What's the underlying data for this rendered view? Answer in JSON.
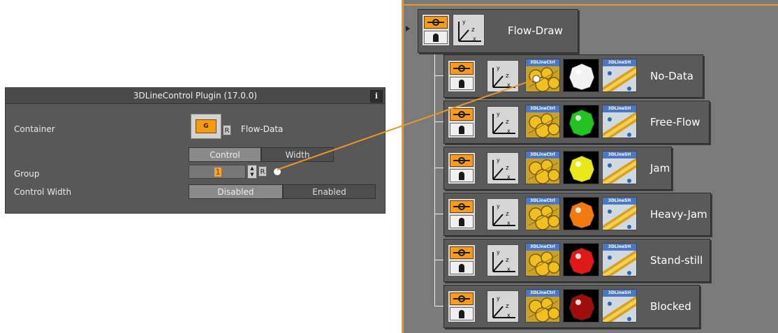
{
  "plugin": {
    "title": "3DLineControl Plugin (17.0.0)",
    "info_label": "i",
    "container_label": "Container",
    "container_icon_text": "G",
    "container_value": "Flow-Data",
    "reset_label": "R",
    "tabs": [
      "Control",
      "Width"
    ],
    "group_label": "Group",
    "group_value": "1",
    "control_width_label": "Control Width",
    "control_width_options": [
      "Disabled",
      "Enabled"
    ],
    "control_width_selected": "Disabled"
  },
  "scene": {
    "root": {
      "label": "Flow-Draw"
    },
    "children": [
      {
        "label": "No-Data",
        "color": "#f2f2f2",
        "color_name": "white"
      },
      {
        "label": "Free-Flow",
        "color": "#22c422",
        "color_name": "green"
      },
      {
        "label": "Jam",
        "color": "#e8e81a",
        "color_name": "yellow"
      },
      {
        "label": "Heavy-Jam",
        "color": "#f27a10",
        "color_name": "orange"
      },
      {
        "label": "Stand-still",
        "color": "#e01818",
        "color_name": "red"
      },
      {
        "label": "Blocked",
        "color": "#a00d0d",
        "color_name": "dark-red"
      }
    ],
    "plugin_caption": "3DLineCtrl",
    "shader_caption": "3DLineSH",
    "accent_color": "#e8962a"
  },
  "icons": {
    "control": "control-pin-icon",
    "axis": "axis-transform-icon",
    "plugin": "3dlinectrl-plugin-icon",
    "material": "material-sphere-icon",
    "shader": "3dlinesh-shader-icon"
  }
}
